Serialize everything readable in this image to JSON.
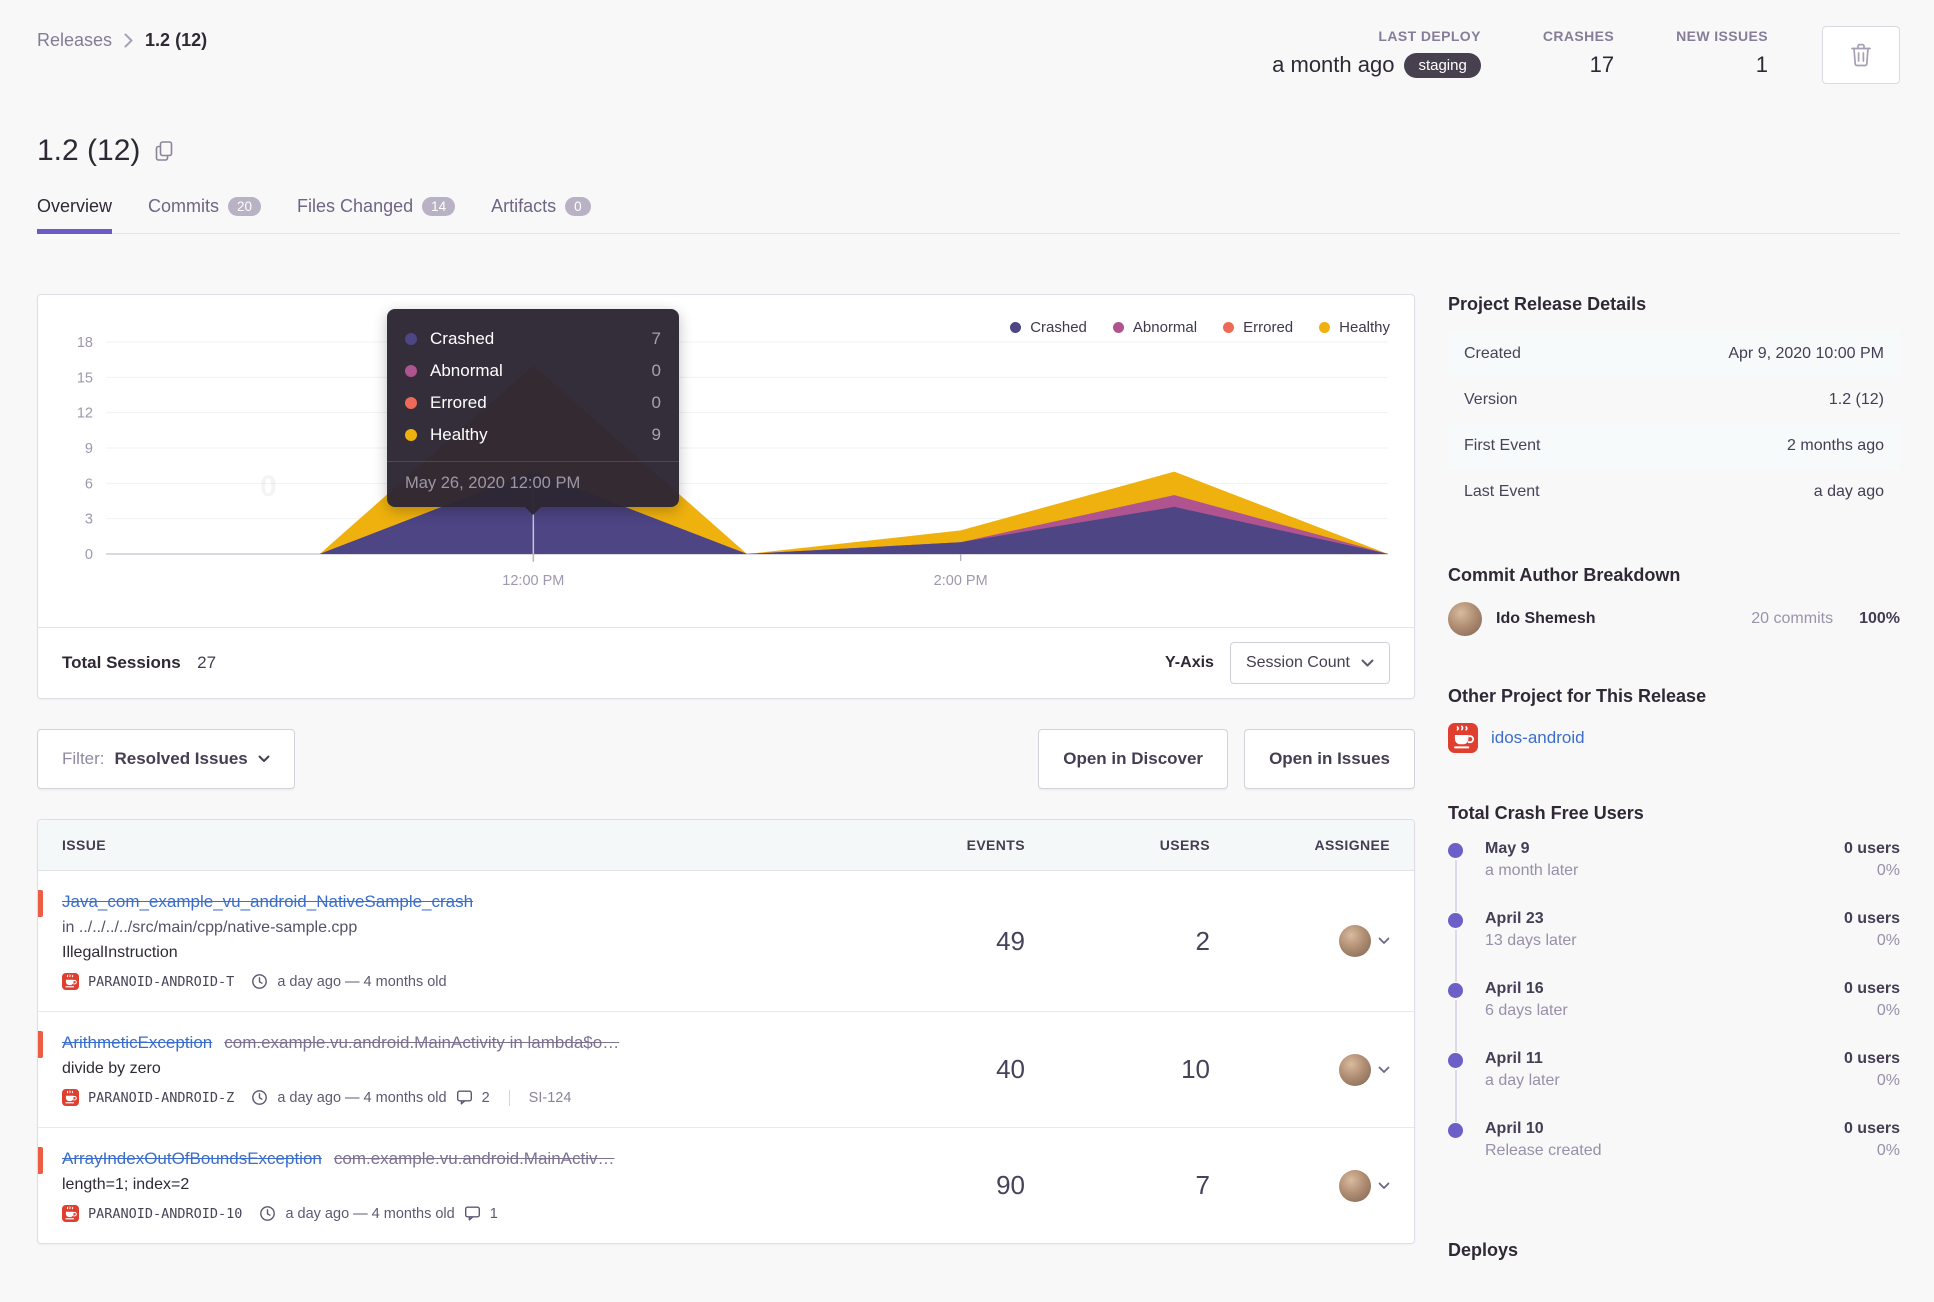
{
  "colors": {
    "accent": "#6a5bc6",
    "link_blue": "#3b6ecc",
    "danger": "#ec5e44",
    "badge_dark": "#46404f"
  },
  "icons": [
    "trash-icon",
    "copy-icon",
    "chevron-right-icon",
    "chevron-down-icon",
    "clock-icon",
    "comments-icon",
    "java-platform-icon"
  ],
  "breadcrumb": {
    "parent": "Releases",
    "current": "1.2 (12)"
  },
  "header_stats": [
    {
      "label": "LAST DEPLOY",
      "value": "a month ago",
      "badge": "staging"
    },
    {
      "label": "CRASHES",
      "value": "17"
    },
    {
      "label": "NEW ISSUES",
      "value": "1"
    }
  ],
  "page_title": "1.2 (12)",
  "tabs": [
    {
      "label": "Overview",
      "active": true
    },
    {
      "label": "Commits",
      "badge": "20"
    },
    {
      "label": "Files Changed",
      "badge": "14"
    },
    {
      "label": "Artifacts",
      "badge": "0"
    }
  ],
  "chart_data": {
    "type": "area",
    "stacked": true,
    "title": "",
    "xlabel": "",
    "ylabel": "Session Count",
    "x": [
      "10:00 AM",
      "11:00 AM",
      "12:00 PM",
      "1:00 PM",
      "2:00 PM",
      "3:00 PM",
      "4:00 PM"
    ],
    "series": [
      {
        "name": "Crashed",
        "color": "#4d4584",
        "values": [
          0,
          0,
          7,
          0,
          1,
          4,
          0
        ]
      },
      {
        "name": "Abnormal",
        "color": "#b0548f",
        "values": [
          0,
          0,
          0,
          0,
          0,
          1,
          0
        ]
      },
      {
        "name": "Errored",
        "color": "#ec6a57",
        "values": [
          0,
          0,
          0,
          0,
          0,
          0,
          0
        ]
      },
      {
        "name": "Healthy",
        "color": "#efb10e",
        "values": [
          0,
          0,
          9,
          0,
          1,
          2,
          0
        ]
      }
    ],
    "ylim": [
      0,
      18
    ],
    "yticks": [
      0,
      3,
      6,
      9,
      12,
      15,
      18
    ],
    "xticks": [
      {
        "label": "12:00 PM",
        "index": 2
      },
      {
        "label": "2:00 PM",
        "index": 4
      }
    ],
    "grid": true,
    "legend_position": "top-right",
    "tooltip_index": 2
  },
  "chart_card": {
    "tooltip": {
      "date": "May 26, 2020 12:00 PM",
      "rows": [
        {
          "label": "Crashed",
          "value": "7",
          "color": "#4d4584"
        },
        {
          "label": "Abnormal",
          "value": "0",
          "color": "#b0548f"
        },
        {
          "label": "Errored",
          "value": "0",
          "color": "#ec6a57"
        },
        {
          "label": "Healthy",
          "value": "9",
          "color": "#efb10e"
        }
      ]
    },
    "footer": {
      "total_label": "Total Sessions",
      "total_value": "27",
      "yaxis_label": "Y-Axis",
      "yaxis_value": "Session Count"
    }
  },
  "filter_bar": {
    "filter_label": "Filter:",
    "filter_value": "Resolved Issues",
    "discover_button": "Open in Discover",
    "issues_button": "Open in Issues"
  },
  "issues_table": {
    "columns": [
      "ISSUE",
      "EVENTS",
      "USERS",
      "ASSIGNEE"
    ],
    "rows": [
      {
        "title": "Java_com_example_vu_android_NativeSample_crash",
        "culprit": "",
        "location": "in ../../../../src/main/cpp/native-sample.cpp",
        "message": "IllegalInstruction",
        "project": "PARANOID-ANDROID-T",
        "age": "a day ago — 4 months old",
        "comments": "",
        "short_id": "",
        "events": "49",
        "users": "2"
      },
      {
        "title": "ArithmeticException",
        "culprit": "com.example.vu.android.MainActivity in lambda$o…",
        "location": "",
        "message": "divide by zero",
        "project": "PARANOID-ANDROID-Z",
        "age": "a day ago — 4 months old",
        "comments": "2",
        "short_id": "SI-124",
        "events": "40",
        "users": "10"
      },
      {
        "title": "ArrayIndexOutOfBoundsException",
        "culprit": "com.example.vu.android.MainActiv…",
        "location": "",
        "message": "length=1; index=2",
        "project": "PARANOID-ANDROID-10",
        "age": "a day ago — 4 months old",
        "comments": "1",
        "short_id": "",
        "events": "90",
        "users": "7"
      }
    ]
  },
  "sidebar": {
    "release_details": {
      "heading": "Project Release Details",
      "rows": [
        {
          "label": "Created",
          "value": "Apr 9, 2020 10:00 PM"
        },
        {
          "label": "Version",
          "value": "1.2 (12)"
        },
        {
          "label": "First Event",
          "value": "2 months ago"
        },
        {
          "label": "Last Event",
          "value": "a day ago"
        }
      ]
    },
    "commit_authors": {
      "heading": "Commit Author Breakdown",
      "author": {
        "name": "Ido Shemesh",
        "commits": "20 commits",
        "percent": "100%"
      }
    },
    "other_project": {
      "heading": "Other Project for This Release",
      "project": "idos-android"
    },
    "crash_free": {
      "heading": "Total Crash Free Users",
      "timeline": [
        {
          "date": "May 9",
          "sub": "a month later",
          "users": "0 users",
          "pct": "0%"
        },
        {
          "date": "April 23",
          "sub": "13 days later",
          "users": "0 users",
          "pct": "0%"
        },
        {
          "date": "April 16",
          "sub": "6 days later",
          "users": "0 users",
          "pct": "0%"
        },
        {
          "date": "April 11",
          "sub": "a day later",
          "users": "0 users",
          "pct": "0%"
        },
        {
          "date": "April 10",
          "sub": "Release created",
          "users": "0 users",
          "pct": "0%"
        }
      ]
    },
    "deploys_heading": "Deploys"
  }
}
